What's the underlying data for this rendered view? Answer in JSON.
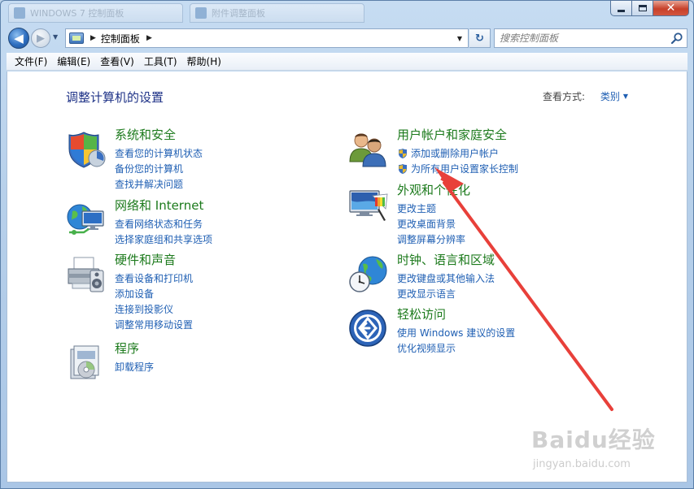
{
  "window": {
    "tabs": [
      {
        "label": "WINDOWS 7 控制面板"
      },
      {
        "label": "附件调整面板"
      }
    ],
    "caption": {
      "minimize": "",
      "maximize": "",
      "close": "✕"
    }
  },
  "nav": {
    "back": "◀",
    "forward": "▶",
    "address": {
      "crumb": "控制面板",
      "separator": "▶"
    },
    "refresh": "↻",
    "search": {
      "placeholder": "搜索控制面板"
    }
  },
  "menubar": {
    "items": [
      "文件(F)",
      "编辑(E)",
      "查看(V)",
      "工具(T)",
      "帮助(H)"
    ]
  },
  "content": {
    "title": "调整计算机的设置",
    "view_by_label": "查看方式:",
    "view_by_value": "类别",
    "left_categories": [
      {
        "title": "系统和安全",
        "icon": "shield-icon",
        "links": [
          "查看您的计算机状态",
          "备份您的计算机",
          "查找并解决问题"
        ]
      },
      {
        "title": "网络和 Internet",
        "icon": "network-icon",
        "links": [
          "查看网络状态和任务",
          "选择家庭组和共享选项"
        ]
      },
      {
        "title": "硬件和声音",
        "icon": "printer-icon",
        "links": [
          "查看设备和打印机",
          "添加设备",
          "连接到投影仪",
          "调整常用移动设置"
        ]
      },
      {
        "title": "程序",
        "icon": "programs-icon",
        "links": [
          "卸载程序"
        ]
      }
    ],
    "right_categories": [
      {
        "title": "用户帐户和家庭安全",
        "icon": "users-icon",
        "links": [
          "添加或删除用户帐户",
          "为所有用户设置家长控制"
        ],
        "shielded": true
      },
      {
        "title": "外观和个性化",
        "icon": "appearance-icon",
        "links": [
          "更改主题",
          "更改桌面背景",
          "调整屏幕分辨率"
        ]
      },
      {
        "title": "时钟、语言和区域",
        "icon": "clock-globe-icon",
        "links": [
          "更改键盘或其他输入法",
          "更改显示语言"
        ]
      },
      {
        "title": "轻松访问",
        "icon": "ease-of-access-icon",
        "links": [
          "使用 Windows 建议的设置",
          "优化视频显示"
        ]
      }
    ]
  },
  "annotation": {
    "arrow_color": "#e8403a"
  },
  "watermark": {
    "brand": "Baidu经验",
    "url": "jingyan.baidu.com"
  }
}
